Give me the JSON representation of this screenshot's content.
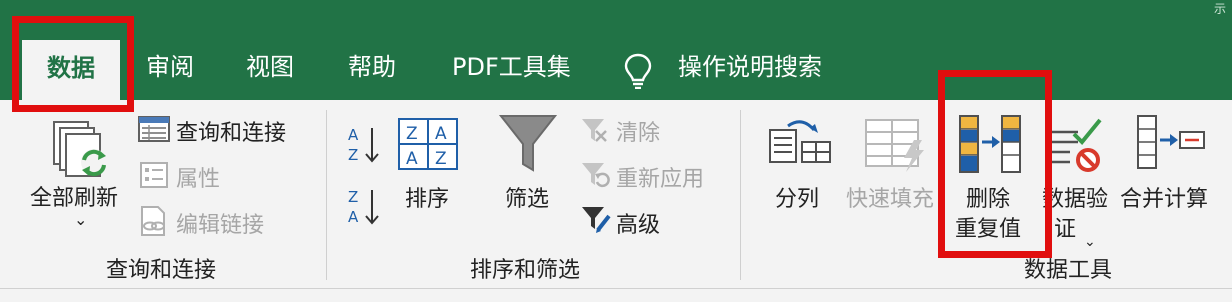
{
  "ribbon_tabs": {
    "data": "数据",
    "review": "审阅",
    "view": "视图",
    "help": "帮助",
    "pdf": "PDF工具集",
    "tell_me": "操作说明搜索"
  },
  "query_group": {
    "refresh_all": "全部刷新",
    "queries_connections": "查询和连接",
    "properties": "属性",
    "edit_links": "编辑链接",
    "group_label": "查询和连接"
  },
  "sort_group": {
    "sort": "排序",
    "filter": "筛选",
    "clear": "清除",
    "reapply": "重新应用",
    "advanced": "高级",
    "group_label": "排序和筛选"
  },
  "tools_group": {
    "text_to_columns": "分列",
    "flash_fill": "快速填充",
    "remove_duplicates_line1": "删除",
    "remove_duplicates_line2": "重复值",
    "data_validation_line1": "数据验",
    "data_validation_line2": "证",
    "consolidate": "合并计算",
    "group_label": "数据工具"
  },
  "corner_caption": "示",
  "colors": {
    "tab_bar": "#217346",
    "ribbon_bg": "#f3f3f3",
    "highlight": "#e10e0e",
    "disabled_text": "#a6a6a6"
  }
}
